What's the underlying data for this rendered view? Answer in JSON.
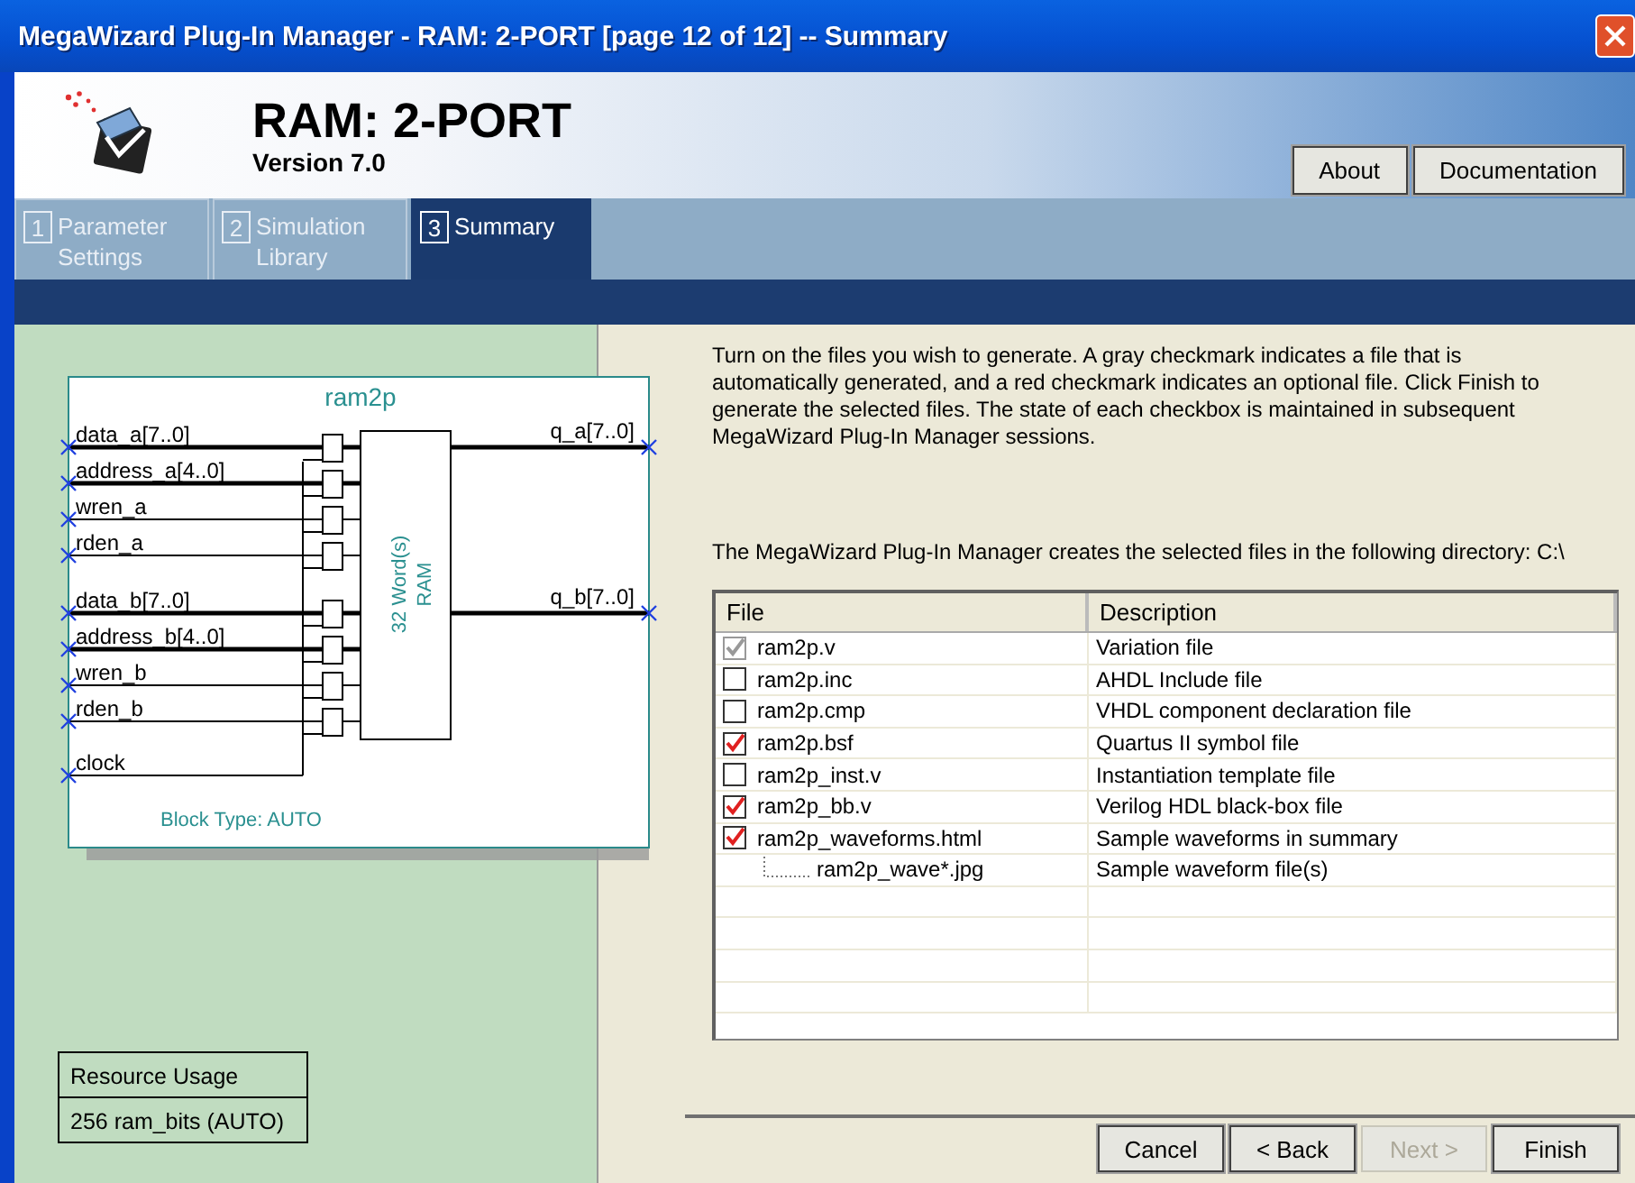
{
  "window": {
    "title": "MegaWizard Plug-In Manager - RAM: 2-PORT [page 12 of 12] -- Summary"
  },
  "header": {
    "title": "RAM: 2-PORT",
    "version": "Version 7.0",
    "buttons": [
      {
        "label": "About"
      },
      {
        "label": "Documentation"
      }
    ]
  },
  "tabs": [
    {
      "number": "1",
      "label": "Parameter Settings",
      "selected": false
    },
    {
      "number": "2",
      "label": "Simulation Library",
      "selected": false
    },
    {
      "number": "3",
      "label": "Summary",
      "selected": true
    }
  ],
  "symbol": {
    "name": "ram2p",
    "inputs": [
      {
        "label": "data_a[7..0]",
        "kind": "bus"
      },
      {
        "label": "address_a[4..0]",
        "kind": "bus"
      },
      {
        "label": "wren_a",
        "kind": "signal"
      },
      {
        "label": "rden_a",
        "kind": "signal"
      },
      {
        "label": "data_b[7..0]",
        "kind": "bus"
      },
      {
        "label": "address_b[4..0]",
        "kind": "bus"
      },
      {
        "label": "wren_b",
        "kind": "signal"
      },
      {
        "label": "rden_b",
        "kind": "signal"
      },
      {
        "label": "clock",
        "kind": "clock"
      }
    ],
    "outputs": [
      {
        "label": "q_a[7..0]"
      },
      {
        "label": "q_b[7..0]"
      }
    ],
    "ram_label": [
      "32 Word(s)",
      "RAM"
    ],
    "block_type": "Block Type: AUTO"
  },
  "resource_usage": {
    "heading": "Resource Usage",
    "value": "256 ram_bits (AUTO)"
  },
  "instructions": "Turn on the files you wish to generate. A gray checkmark indicates a file that is automatically generated, and a red checkmark indicates an optional file. Click Finish to generate the selected files. The state of each checkbox is maintained in subsequent MegaWizard Plug-In Manager sessions.",
  "directory_note": "The MegaWizard Plug-In Manager creates the selected files in the following directory: C:\\",
  "file_table": {
    "columns": [
      "File",
      "Description"
    ],
    "rows": [
      {
        "file": "ram2p.v",
        "description": "Variation file",
        "checked": true,
        "disabled": true
      },
      {
        "file": "ram2p.inc",
        "description": "AHDL Include file",
        "checked": false,
        "disabled": false
      },
      {
        "file": "ram2p.cmp",
        "description": "VHDL component declaration file",
        "checked": false,
        "disabled": false
      },
      {
        "file": "ram2p.bsf",
        "description": "Quartus II symbol file",
        "checked": true,
        "disabled": false
      },
      {
        "file": "ram2p_inst.v",
        "description": "Instantiation template file",
        "checked": false,
        "disabled": false
      },
      {
        "file": "ram2p_bb.v",
        "description": "Verilog HDL black-box file",
        "checked": true,
        "disabled": false
      },
      {
        "file": "ram2p_waveforms.html",
        "description": "Sample waveforms in summary",
        "checked": true,
        "disabled": false,
        "children": [
          {
            "file": "ram2p_wave*.jpg",
            "description": "Sample waveform file(s)"
          }
        ]
      }
    ]
  },
  "buttons": [
    {
      "label": "Cancel",
      "disabled": false
    },
    {
      "label": "< Back",
      "disabled": false
    },
    {
      "label": "Next >",
      "disabled": true
    },
    {
      "label": "Finish",
      "disabled": false
    }
  ]
}
